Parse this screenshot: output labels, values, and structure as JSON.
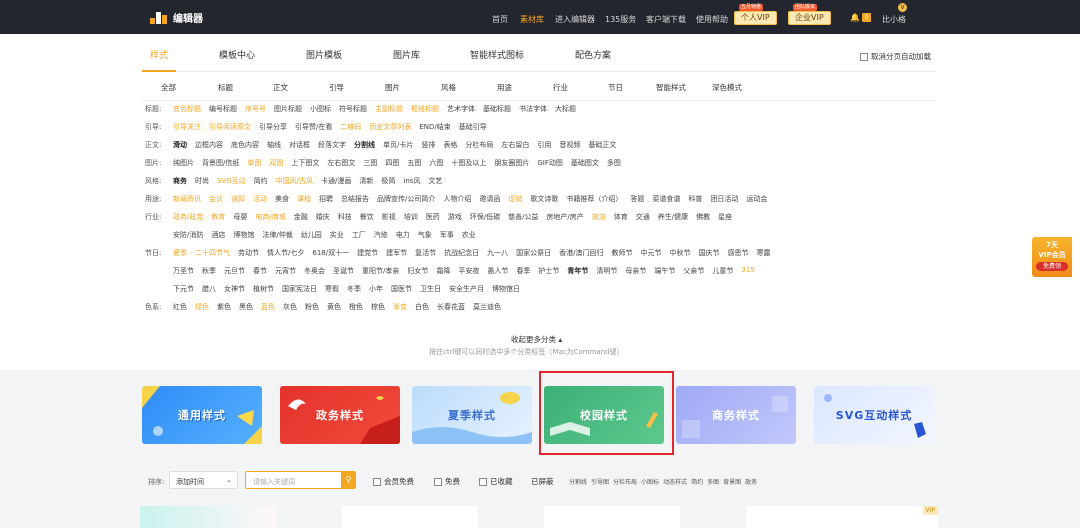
{
  "header": {
    "logo_text": "编辑器",
    "nav": [
      "首页",
      "素材库",
      "进入编辑器",
      "135服务",
      "客户端下载",
      "使用帮助"
    ],
    "personal_vip": {
      "label": "个人VIP",
      "tag": "五月特惠"
    },
    "enterprise_vip": {
      "label": "企业VIP",
      "tag": "团队版本"
    },
    "notification_count": "0",
    "avatar_badge": "V",
    "username": "比小格"
  },
  "main_tabs": [
    "样式",
    "模板中心",
    "图片模板",
    "图片库",
    "智能样式图标",
    "配色方案"
  ],
  "auto_load": "取消分页自动加载",
  "sub_tabs": [
    "全部",
    "标题",
    "正文",
    "引导",
    "图片",
    "风格",
    "用途",
    "行业",
    "节日",
    "智能样式",
    "深色模式"
  ],
  "filters": [
    {
      "label": "标题:",
      "items": [
        {
          "t": "底色标题",
          "h": true
        },
        {
          "t": "编号标题"
        },
        {
          "t": "序号号",
          "h": true
        },
        {
          "t": "图片标题"
        },
        {
          "t": "小图标"
        },
        {
          "t": "符号标题"
        },
        {
          "t": "主副标题",
          "h": true
        },
        {
          "t": "框线标题",
          "h": true
        },
        {
          "t": "艺术字体"
        },
        {
          "t": "基础标题"
        },
        {
          "t": "书法字体"
        },
        {
          "t": "大标题"
        }
      ]
    },
    {
      "label": "引导:",
      "items": [
        {
          "t": "引导关注",
          "h": true
        },
        {
          "t": "引导阅读原文",
          "h": true
        },
        {
          "t": "引导分享"
        },
        {
          "t": "引导赞/在看"
        },
        {
          "t": "二维码",
          "h": true
        },
        {
          "t": "历史文章列表",
          "h": true
        },
        {
          "t": "END/结束"
        },
        {
          "t": "基础引导"
        }
      ]
    },
    {
      "label": "正文:",
      "items": [
        {
          "t": "滑动",
          "b": true
        },
        {
          "t": "边框内容"
        },
        {
          "t": "底色内容"
        },
        {
          "t": "轴线"
        },
        {
          "t": "对话框"
        },
        {
          "t": "段落文字"
        },
        {
          "t": "分割线",
          "b": true
        },
        {
          "t": "单页/卡片"
        },
        {
          "t": "竖排"
        },
        {
          "t": "表格"
        },
        {
          "t": "分栏布局"
        },
        {
          "t": "左右留白"
        },
        {
          "t": "引用"
        },
        {
          "t": "音视频"
        },
        {
          "t": "基础正文"
        }
      ]
    },
    {
      "label": "图片:",
      "items": [
        {
          "t": "纯图片"
        },
        {
          "t": "背景图/信纸"
        },
        {
          "t": "单图",
          "h": true
        },
        {
          "t": "双图",
          "h": true
        },
        {
          "t": "上下图文"
        },
        {
          "t": "左右图文"
        },
        {
          "t": "三图"
        },
        {
          "t": "四图"
        },
        {
          "t": "五图"
        },
        {
          "t": "六图"
        },
        {
          "t": "十图及以上"
        },
        {
          "t": "朋友圈图片"
        },
        {
          "t": "GIF动图"
        },
        {
          "t": "基础图文"
        },
        {
          "t": "多图"
        }
      ]
    },
    {
      "label": "风格:",
      "items": [
        {
          "t": "商务",
          "b": true
        },
        {
          "t": "时尚"
        },
        {
          "t": "SVG互动",
          "h": true
        },
        {
          "t": "简约"
        },
        {
          "t": "中国风/古风",
          "h": true
        },
        {
          "t": "卡通/漫画"
        },
        {
          "t": "清新"
        },
        {
          "t": "极简"
        },
        {
          "t": "ins风"
        },
        {
          "t": "文艺"
        }
      ]
    },
    {
      "label": "用途:",
      "items": [
        {
          "t": "新闻资讯",
          "h": true
        },
        {
          "t": "会议",
          "h": true
        },
        {
          "t": "通知",
          "h": true
        },
        {
          "t": "活动",
          "h": true
        },
        {
          "t": "美食"
        },
        {
          "t": "课程",
          "h": true
        },
        {
          "t": "招聘"
        },
        {
          "t": "总结报告"
        },
        {
          "t": "品牌宣传/公司简介"
        },
        {
          "t": "人物介绍"
        },
        {
          "t": "邀请函"
        },
        {
          "t": "促销",
          "h": true
        },
        {
          "t": "歌文诗歌"
        },
        {
          "t": "书籍推荐（介绍）"
        },
        {
          "t": "答题"
        },
        {
          "t": "菜谱食谱"
        },
        {
          "t": "科普"
        },
        {
          "t": "团日活动"
        },
        {
          "t": "运动会"
        }
      ]
    },
    {
      "label": "行业:",
      "items": [
        {
          "t": "政务/政党",
          "h": true
        },
        {
          "t": "教育",
          "h": true
        },
        {
          "t": "母婴"
        },
        {
          "t": "电商/商城",
          "h": true
        },
        {
          "t": "金融"
        },
        {
          "t": "婚庆"
        },
        {
          "t": "科技"
        },
        {
          "t": "餐饮"
        },
        {
          "t": "影视"
        },
        {
          "t": "培训"
        },
        {
          "t": "医药"
        },
        {
          "t": "游戏"
        },
        {
          "t": "环保/低碳"
        },
        {
          "t": "慈善/公益"
        },
        {
          "t": "房地产/房产"
        },
        {
          "t": "旅游",
          "h": true
        },
        {
          "t": "体育"
        },
        {
          "t": "交通"
        },
        {
          "t": "养生/健康"
        },
        {
          "t": "佛教"
        },
        {
          "t": "星座"
        }
      ]
    },
    {
      "label": "",
      "items": [
        {
          "t": "安防/消防"
        },
        {
          "t": "酒店"
        },
        {
          "t": "博物馆"
        },
        {
          "t": "法律/仲裁"
        },
        {
          "t": "幼儿园"
        },
        {
          "t": "实业"
        },
        {
          "t": "工厂"
        },
        {
          "t": "汽修"
        },
        {
          "t": "电力"
        },
        {
          "t": "气象"
        },
        {
          "t": "军事"
        },
        {
          "t": "农业"
        }
      ]
    },
    {
      "label": "节日:",
      "items": [
        {
          "t": "夏季",
          "h": true
        },
        {
          "t": "二十四节气",
          "h": true
        },
        {
          "t": "劳动节"
        },
        {
          "t": "情人节/七夕"
        },
        {
          "t": "618/双十一"
        },
        {
          "t": "建党节"
        },
        {
          "t": "建军节"
        },
        {
          "t": "复活节"
        },
        {
          "t": "抗战纪念日"
        },
        {
          "t": "九一八"
        },
        {
          "t": "国家公祭日"
        },
        {
          "t": "香港/澳门回归"
        },
        {
          "t": "教师节"
        },
        {
          "t": "中元节"
        },
        {
          "t": "中秋节"
        },
        {
          "t": "国庆节"
        },
        {
          "t": "感恩节"
        },
        {
          "t": "寒露"
        }
      ]
    },
    {
      "label": "",
      "items": [
        {
          "t": "万圣节"
        },
        {
          "t": "秋季"
        },
        {
          "t": "元旦节"
        },
        {
          "t": "春节"
        },
        {
          "t": "元宵节"
        },
        {
          "t": "冬奥会"
        },
        {
          "t": "圣诞节"
        },
        {
          "t": "重阳节/孝亲"
        },
        {
          "t": "妇女节"
        },
        {
          "t": "霜降"
        },
        {
          "t": "平安夜"
        },
        {
          "t": "愚人节"
        },
        {
          "t": "春季"
        },
        {
          "t": "护士节"
        },
        {
          "t": "青年节",
          "b": true
        },
        {
          "t": "清明节"
        },
        {
          "t": "母亲节"
        },
        {
          "t": "端午节"
        },
        {
          "t": "父亲节"
        },
        {
          "t": "儿童节"
        },
        {
          "t": "315",
          "h": true
        }
      ]
    },
    {
      "label": "",
      "items": [
        {
          "t": "下元节"
        },
        {
          "t": "腊八"
        },
        {
          "t": "女神节"
        },
        {
          "t": "植树节"
        },
        {
          "t": "国家宪法日"
        },
        {
          "t": "寒假"
        },
        {
          "t": "冬季"
        },
        {
          "t": "小年"
        },
        {
          "t": "国医节"
        },
        {
          "t": "卫生日"
        },
        {
          "t": "安全生产月"
        },
        {
          "t": "博物馆日"
        }
      ]
    },
    {
      "label": "色系:",
      "items": [
        {
          "t": "红色"
        },
        {
          "t": "绿色",
          "h": true
        },
        {
          "t": "紫色"
        },
        {
          "t": "黑色"
        },
        {
          "t": "蓝色",
          "h": true
        },
        {
          "t": "灰色"
        },
        {
          "t": "粉色"
        },
        {
          "t": "黄色"
        },
        {
          "t": "橙色"
        },
        {
          "t": "棕色"
        },
        {
          "t": "渐变",
          "h": true
        },
        {
          "t": "白色"
        },
        {
          "t": "长春花蓝"
        },
        {
          "t": "莫兰迪色"
        }
      ]
    }
  ],
  "collapse_label": "收起更多分类",
  "hint": "按住ctrl键可以同时选中多个分类标签（Mac为Command键）",
  "side_promo": {
    "line1": "7天",
    "line2": "VIP会员",
    "line3": "免费领"
  },
  "banners": [
    "通用样式",
    "政务样式",
    "夏季样式",
    "校园样式",
    "商务样式",
    "SVG互动样式"
  ],
  "filter_bar": {
    "sort_label": "排序:",
    "sort_value": "添加时间",
    "search_placeholder": "请输入关键词",
    "checkboxes": [
      "会员免费",
      "免费",
      "已收藏"
    ],
    "blocked": "已屏蔽",
    "tags": [
      "分割线",
      "引导图",
      "分栏布局",
      "小图标",
      "动态样式",
      "简约",
      "多图",
      "背景图",
      "政务"
    ]
  },
  "card_vip": "VIP",
  "colors": {
    "accent": "#f5a623",
    "topbar": "#23262e",
    "selection": "#e3282d"
  }
}
